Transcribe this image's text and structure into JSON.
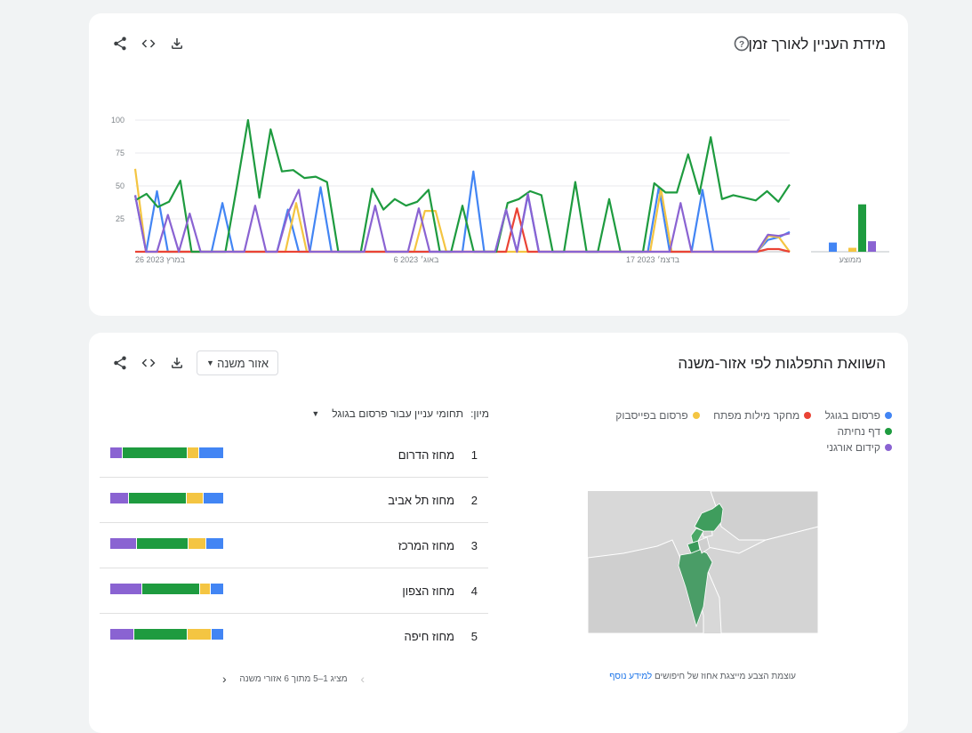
{
  "interest_card": {
    "title": "מידת העניין לאורך זמן",
    "icons": [
      "share-icon",
      "embed-icon",
      "download-icon",
      "help-icon"
    ],
    "average_label": "ממוצע"
  },
  "region_card": {
    "title": "השוואת התפלגות לפי אזור-משנה",
    "dropdown": "אזור משנה",
    "legend": [
      {
        "name": "פרסום בגוגל",
        "color": "#4285f4"
      },
      {
        "name": "מחקר מילות מפתח",
        "color": "#ea4335"
      },
      {
        "name": "פרסום בפייסבוק",
        "color": "#f4c542"
      },
      {
        "name": "דף נחיתה",
        "color": "#1e9b3f"
      },
      {
        "name": "קידום אורגני",
        "color": "#8a63d2"
      }
    ],
    "sort_label": "מיון:",
    "sort_value": "תחומי עניין עבור פרסום בגוגל",
    "regions": [
      {
        "rank": "1",
        "name": "מחוז הדרום",
        "shares": {
          "blue": 21,
          "yellow": 10,
          "green": 57,
          "purple": 10
        }
      },
      {
        "rank": "2",
        "name": "מחוז תל אביב",
        "shares": {
          "blue": 17,
          "yellow": 15,
          "green": 50,
          "purple": 16
        }
      },
      {
        "rank": "3",
        "name": "מחוז המרכז",
        "shares": {
          "blue": 15,
          "yellow": 15,
          "green": 44,
          "purple": 23
        }
      },
      {
        "rank": "4",
        "name": "מחוז הצפון",
        "shares": {
          "blue": 11,
          "yellow": 9,
          "green": 51,
          "purple": 28
        }
      },
      {
        "rank": "5",
        "name": "מחוז חיפה",
        "shares": {
          "blue": 10,
          "yellow": 21,
          "green": 47,
          "purple": 21
        }
      }
    ],
    "pager_text": "מציג 1–5 מתוך 6 אזורי משנה",
    "map_note_text": "עוצמת הצבע מייצגת אחוז של חיפושים",
    "map_note_link": "למידע נוסף"
  },
  "chart_data": {
    "type": "line",
    "x_labels": [
      "26 במרץ 2023",
      "6 באוג׳ 2023",
      "17 בדצמ׳ 2023"
    ],
    "y_ticks": [
      25,
      50,
      75,
      100
    ],
    "ylim": [
      0,
      100
    ],
    "grid": true,
    "series": [
      {
        "name": "דף נחיתה",
        "color": "#1e9b3f",
        "values": [
          39,
          44,
          34,
          38,
          54,
          0,
          0,
          0,
          0,
          49,
          100,
          41,
          93,
          61,
          62,
          56,
          57,
          53,
          0,
          0,
          0,
          48,
          32,
          40,
          35,
          38,
          47,
          0,
          0,
          35,
          0,
          0,
          0,
          37,
          40,
          46,
          43,
          0,
          0,
          53,
          0,
          0,
          40,
          0,
          0,
          0,
          52,
          45,
          45,
          74,
          44,
          87,
          40,
          43,
          41,
          39,
          46,
          38,
          51
        ]
      },
      {
        "name": "פרסום בגוגל",
        "color": "#4285f4",
        "values": [
          43,
          0,
          46,
          0,
          0,
          0,
          0,
          0,
          37,
          0,
          0,
          0,
          0,
          0,
          32,
          0,
          0,
          49,
          0,
          0,
          0,
          0,
          0,
          0,
          0,
          0,
          0,
          0,
          0,
          0,
          0,
          61,
          0,
          0,
          32,
          0,
          43,
          0,
          0,
          0,
          0,
          0,
          0,
          0,
          0,
          0,
          0,
          0,
          49,
          0,
          0,
          0,
          47,
          0,
          0,
          0,
          0,
          0,
          9,
          11,
          15
        ]
      },
      {
        "name": "פרסום בפייסבוק",
        "color": "#f4c542",
        "values": [
          63,
          0,
          0,
          0,
          0,
          0,
          0,
          0,
          0,
          0,
          0,
          0,
          0,
          0,
          0,
          37,
          0,
          0,
          0,
          0,
          0,
          0,
          0,
          0,
          0,
          0,
          0,
          31,
          31,
          0,
          0,
          0,
          0,
          0,
          0,
          0,
          0,
          0,
          0,
          0,
          0,
          0,
          0,
          0,
          0,
          0,
          0,
          0,
          0,
          48,
          0,
          0,
          0,
          0,
          0,
          0,
          0,
          0,
          0,
          12,
          11,
          0
        ]
      },
      {
        "name": "מחקר מילות מפתח",
        "color": "#ea4335",
        "values": [
          0,
          0,
          0,
          0,
          0,
          0,
          0,
          0,
          0,
          0,
          0,
          0,
          0,
          0,
          0,
          0,
          0,
          0,
          0,
          0,
          0,
          0,
          0,
          0,
          0,
          0,
          0,
          0,
          0,
          0,
          0,
          0,
          0,
          0,
          0,
          33,
          0,
          0,
          0,
          0,
          0,
          0,
          0,
          0,
          0,
          0,
          0,
          0,
          0,
          0,
          0,
          0,
          0,
          0,
          0,
          0,
          0,
          0,
          2,
          2,
          0
        ]
      },
      {
        "name": "קידום אורגני",
        "color": "#8a63d2",
        "values": [
          43,
          0,
          0,
          28,
          0,
          29,
          0,
          0,
          0,
          0,
          0,
          35,
          0,
          0,
          29,
          47,
          0,
          0,
          0,
          0,
          0,
          0,
          35,
          0,
          0,
          0,
          33,
          0,
          0,
          0,
          0,
          0,
          0,
          0,
          32,
          0,
          44,
          0,
          0,
          0,
          0,
          0,
          0,
          0,
          0,
          0,
          0,
          0,
          0,
          0,
          37,
          0,
          0,
          0,
          0,
          0,
          0,
          0,
          13,
          12,
          14
        ]
      }
    ],
    "averages": {
      "פרסום בגוגל": 7,
      "מחקר מילות מפתח": 0,
      "פרסום בפייסבוק": 3,
      "דף נחיתה": 36,
      "קידום אורגני": 8
    }
  }
}
